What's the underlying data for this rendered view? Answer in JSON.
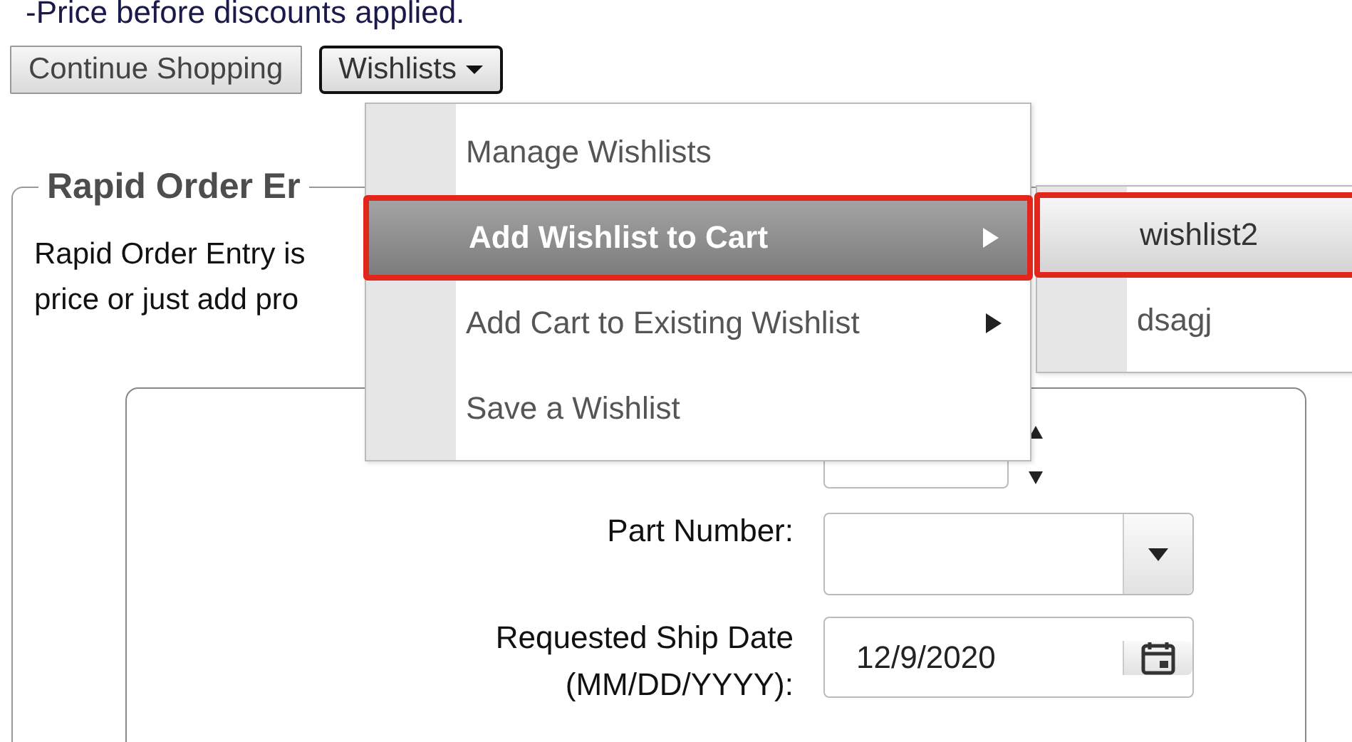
{
  "notice": "-Price before discounts applied.",
  "buttons": [
    {
      "label": "Continue Shopping",
      "kind": "plain",
      "focused": false
    },
    {
      "label": "Wishlists",
      "kind": "dropdown",
      "focused": true
    }
  ],
  "section": {
    "legend": "Rapid Order Er",
    "description_lines": [
      "Rapid Order Entry is",
      "price or just add pro"
    ]
  },
  "form": {
    "part_number": {
      "label": "Part Number:"
    },
    "ship_date": {
      "label": "Requested Ship Date (MM/DD/YYYY):",
      "value": "12/9/2020"
    }
  },
  "wishlist_menu": {
    "items": [
      {
        "label": "Manage Wishlists",
        "selected": false,
        "has_submenu": false,
        "annotated": false
      },
      {
        "label": "Add Wishlist to Cart",
        "selected": true,
        "has_submenu": true,
        "annotated": true
      },
      {
        "label": "Add Cart to Existing Wishlist",
        "selected": false,
        "has_submenu": true,
        "annotated": false
      },
      {
        "label": "Save a Wishlist",
        "selected": false,
        "has_submenu": false,
        "annotated": false
      }
    ]
  },
  "submenu": {
    "items": [
      {
        "label": "wishlist2",
        "selected": true,
        "annotated": true
      },
      {
        "label": "dsagj",
        "selected": false,
        "annotated": false
      }
    ]
  }
}
